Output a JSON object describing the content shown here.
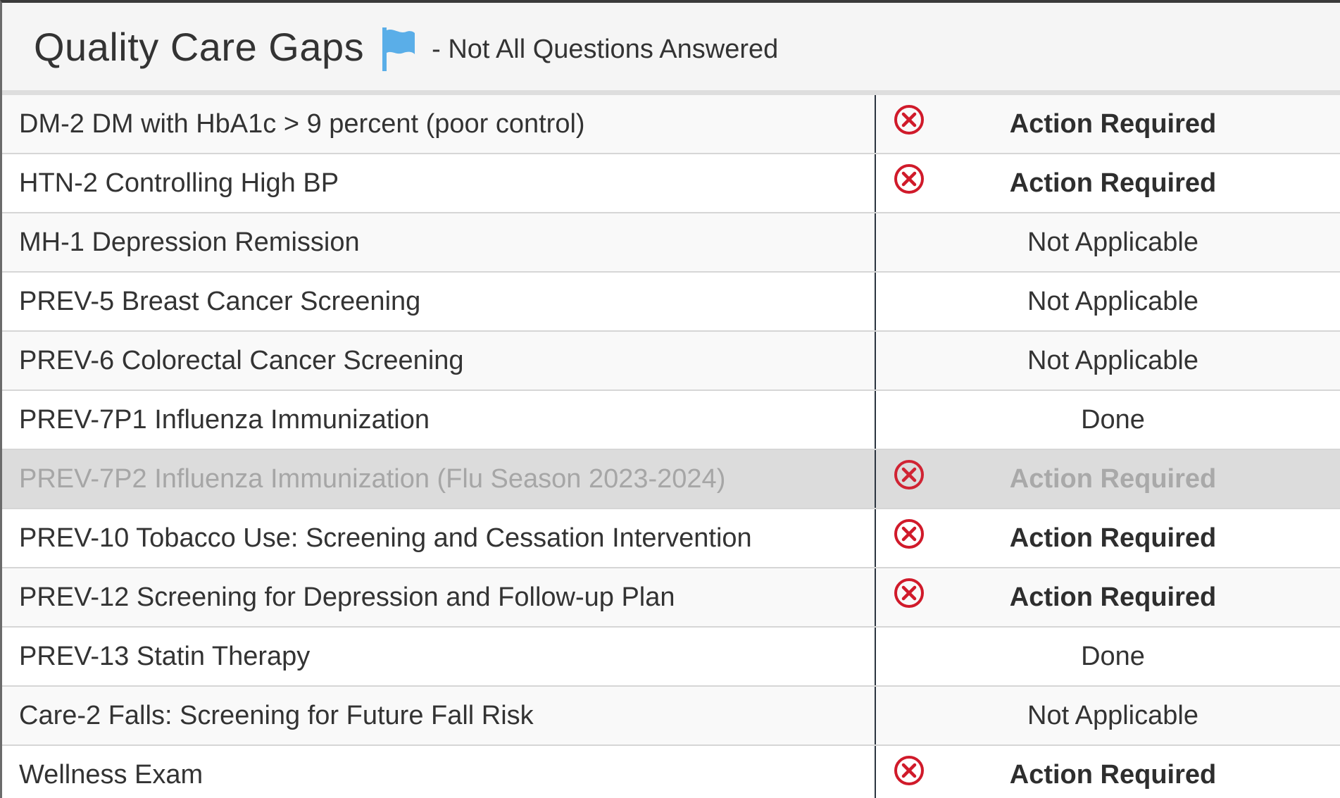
{
  "header": {
    "title": "Quality Care Gaps",
    "flag_icon": "flag-icon",
    "note": "- Not All Questions Answered"
  },
  "colors": {
    "flag": "#5aaee8",
    "error_icon": "#d01a2a",
    "disabled_row": "#dcdcdc"
  },
  "rows": [
    {
      "name": "DM-2 DM with HbA1c > 9 percent (poor control)",
      "status": "Action Required",
      "icon": "error-circle-icon"
    },
    {
      "name": "HTN-2 Controlling High BP",
      "status": "Action Required",
      "icon": "error-circle-icon"
    },
    {
      "name": "MH-1 Depression Remission",
      "status": "Not Applicable"
    },
    {
      "name": "PREV-5 Breast Cancer Screening",
      "status": "Not Applicable"
    },
    {
      "name": "PREV-6 Colorectal Cancer Screening",
      "status": "Not Applicable"
    },
    {
      "name": "PREV-7P1 Influenza Immunization",
      "status": "Done"
    },
    {
      "name": "PREV-7P2 Influenza Immunization (Flu Season 2023-2024)",
      "status": "Action Required",
      "icon": "error-circle-icon",
      "disabled": true
    },
    {
      "name": "PREV-10 Tobacco Use: Screening and Cessation Intervention",
      "status": "Action Required",
      "icon": "error-circle-icon"
    },
    {
      "name": "PREV-12 Screening for Depression and Follow-up Plan",
      "status": "Action Required",
      "icon": "error-circle-icon"
    },
    {
      "name": "PREV-13 Statin Therapy",
      "status": "Done"
    },
    {
      "name": "Care-2 Falls: Screening for Future Fall Risk",
      "status": "Not Applicable"
    },
    {
      "name": "Wellness Exam",
      "status": "Action Required",
      "icon": "error-circle-icon"
    }
  ]
}
